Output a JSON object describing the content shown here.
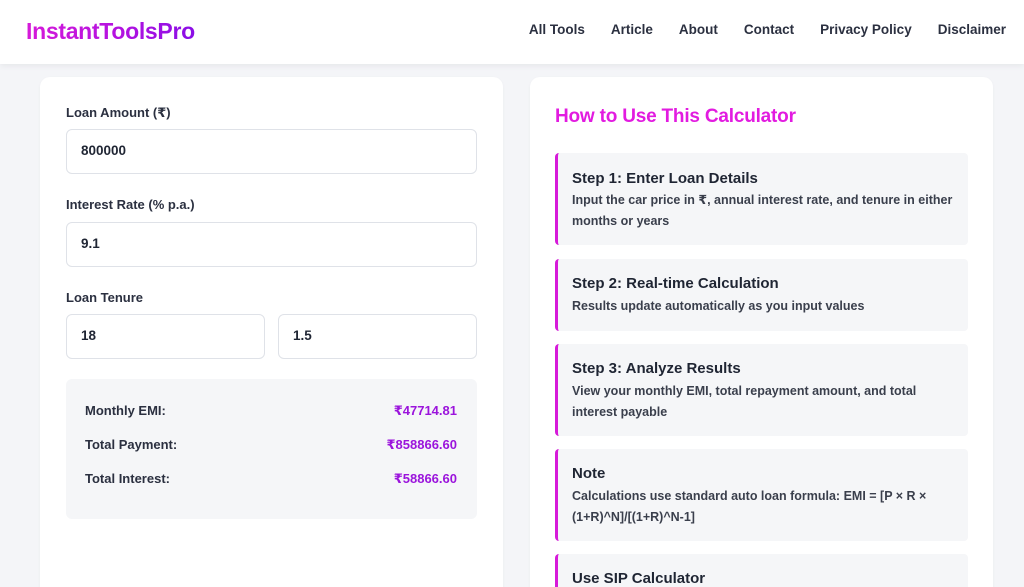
{
  "header": {
    "logo": "InstantToolsPro",
    "nav": [
      "All Tools",
      "Article",
      "About",
      "Contact",
      "Privacy Policy",
      "Disclaimer"
    ]
  },
  "form": {
    "loan_amount_label": "Loan Amount (₹)",
    "loan_amount_value": "800000",
    "interest_rate_label": "Interest Rate (% p.a.)",
    "interest_rate_value": "9.1",
    "tenure_label": "Loan Tenure",
    "tenure_months_value": "18",
    "tenure_years_value": "1.5"
  },
  "results": {
    "monthly_emi_label": "Monthly EMI:",
    "monthly_emi_value": "₹47714.81",
    "total_payment_label": "Total Payment:",
    "total_payment_value": "₹858866.60",
    "total_interest_label": "Total Interest:",
    "total_interest_value": "₹58866.60"
  },
  "howto": {
    "title": "How to Use This Calculator",
    "steps": [
      {
        "title": "Step 1: Enter Loan Details",
        "desc": "Input the car price in ₹, annual interest rate, and tenure in either months or years"
      },
      {
        "title": "Step 2: Real-time Calculation",
        "desc": "Results update automatically as you input values"
      },
      {
        "title": "Step 3: Analyze Results",
        "desc": "View your monthly EMI, total repayment amount, and total interest payable"
      },
      {
        "title": "Note",
        "desc": "Calculations use standard auto loan formula: EMI = [P × R × (1+R)^N]/[(1+R)^N-1]"
      },
      {
        "title": "Use SIP Calculator",
        "desc": ""
      }
    ]
  },
  "colors": {
    "accent": "#d61ad9",
    "value_purple": "#9b14dc"
  }
}
